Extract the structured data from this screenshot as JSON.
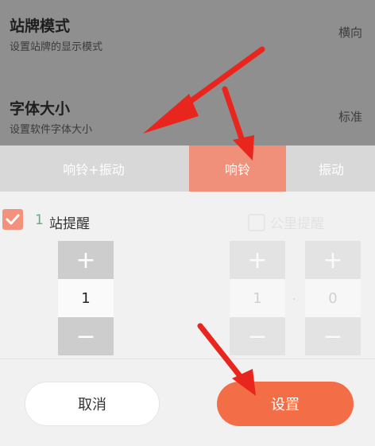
{
  "settings": {
    "rows": [
      {
        "title": "站牌模式",
        "subtitle": "设置站牌的显示模式",
        "value": "横向"
      },
      {
        "title": "字体大小",
        "subtitle": "设置软件字体大小",
        "value": "标准"
      }
    ]
  },
  "dialog": {
    "tabs": [
      {
        "label": "响铃+振动",
        "active": false
      },
      {
        "label": "响铃",
        "active": true
      },
      {
        "label": "振动",
        "active": false
      }
    ],
    "station_reminder": {
      "checked": true,
      "count": "1",
      "label": "站提醒"
    },
    "distance_reminder": {
      "checked": false,
      "label": "公里提醒"
    },
    "station_stepper": {
      "plus": "+",
      "value": "1",
      "minus": "−"
    },
    "distance_stepper_int": {
      "plus": "+",
      "value": "1",
      "minus": "−"
    },
    "distance_stepper_dec": {
      "plus": "+",
      "value": "0",
      "minus": "−"
    },
    "separator": "·",
    "cancel_label": "取消",
    "set_label": "设置"
  },
  "colors": {
    "accent_tab": "#f0907a",
    "primary_button": "#f36e47",
    "arrow": "#e8261e"
  }
}
